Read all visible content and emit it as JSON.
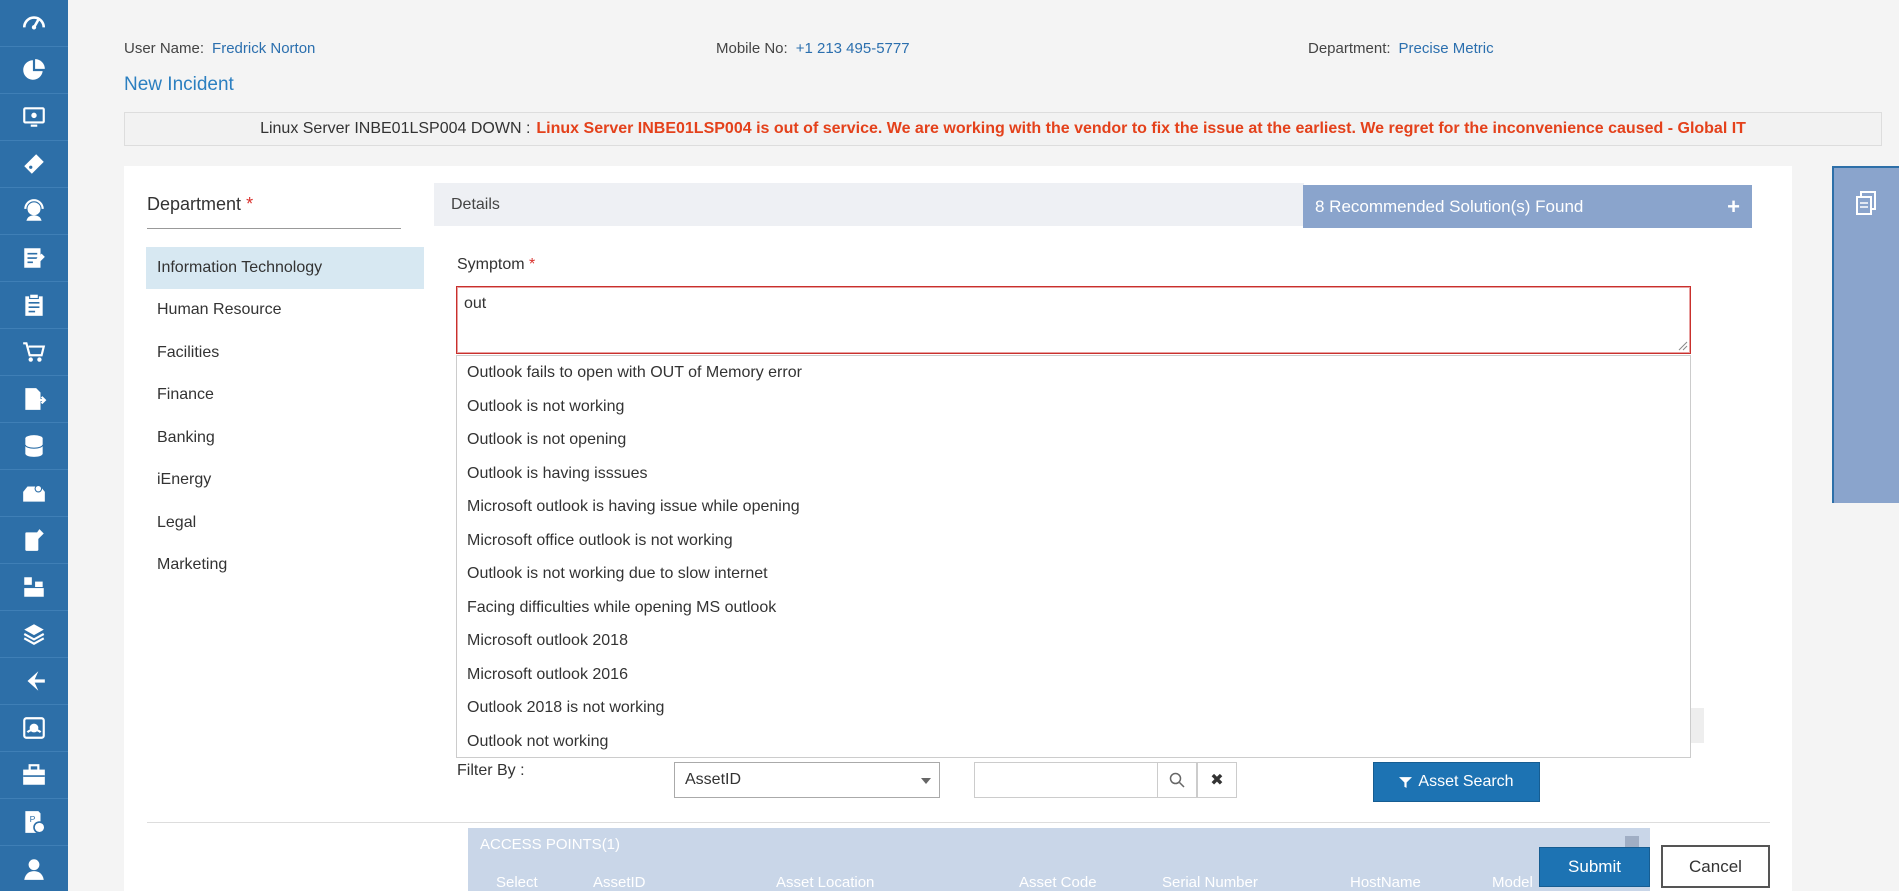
{
  "user": {
    "name_label": "User Name:",
    "name_value": "Fredrick Norton",
    "mobile_label": "Mobile No:",
    "mobile_value": "+1 213 495-5777",
    "dept_label": "Department:",
    "dept_value": "Precise Metric"
  },
  "page_title": "New Incident",
  "banner": {
    "title": "Linux Server INBE01LSP004 DOWN :",
    "message": "Linux Server INBE01LSP004 is out of service. We are working with the vendor to fix the issue at the earliest. We regret for the inconvenience caused - Global IT"
  },
  "department": {
    "heading": "Department",
    "required_mark": "*",
    "items": [
      "Information Technology",
      "Human Resource",
      "Facilities",
      "Finance",
      "Banking",
      "iEnergy",
      "Legal",
      "Marketing"
    ],
    "selected": "Information Technology"
  },
  "tabs": {
    "details": "Details",
    "recommended": "8 Recommended Solution(s) Found",
    "recommended_plus": "+"
  },
  "symptom": {
    "label": "Symptom",
    "required_mark": "*",
    "value": "out",
    "suggestions": [
      "Outlook fails to open with OUT of Memory error",
      "Outlook is not working",
      "Outlook is not opening",
      "Outlook is having isssues",
      "Microsoft outlook is having issue while opening",
      "Microsoft office outlook is not working",
      "Outlook is not working due to slow internet",
      "Facing difficulties while opening MS outlook",
      "Microsoft outlook 2018",
      "Microsoft outlook 2016",
      "Outlook 2018 is not working",
      "Outlook not working"
    ]
  },
  "filter": {
    "label": "Filter By :",
    "selected": "AssetID",
    "search_value": "",
    "clear_label": "✖",
    "asset_search_label": "Asset Search"
  },
  "access_points": {
    "title": "ACCESS POINTS(1)",
    "columns": [
      "Select",
      "AssetID",
      "Asset Location",
      "Asset Code",
      "Serial Number",
      "HostName",
      "Model"
    ]
  },
  "actions": {
    "submit": "Submit",
    "cancel": "Cancel"
  },
  "sidebar_icons": [
    "dashboard-icon",
    "pie-chart-icon",
    "monitor-icon",
    "ticket-icon",
    "support-agent-icon",
    "edit-document-icon",
    "clipboard-icon",
    "cart-icon",
    "document-arrow-icon",
    "database-icon",
    "inbox-user-icon",
    "mobile-edit-icon",
    "flowchart-icon",
    "stack-icon",
    "release-icon",
    "headset-settings-icon",
    "briefcase-icon",
    "document-settings-icon",
    "user-icon"
  ],
  "colors": {
    "sidebar": "#2d6fa8",
    "accent": "#1d73b3",
    "banner_alert": "#e4411b",
    "recommend_bg": "#8aa4cc",
    "required": "#d9302c"
  }
}
